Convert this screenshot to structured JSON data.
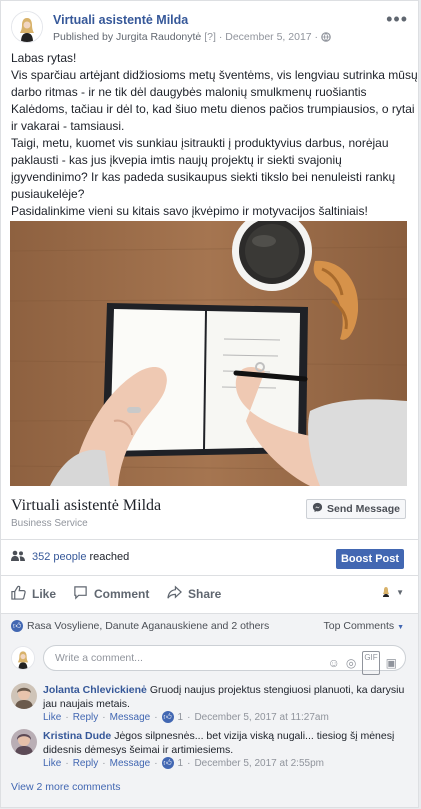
{
  "post": {
    "page_name": "Virtuali asistentė Milda",
    "published_by": "Published by",
    "author": "Jurgita Raudonytė",
    "help_mark": "[?]",
    "separator": "·",
    "date": "December 5, 2017",
    "privacy_icon": "globe-icon",
    "more_icon": "more-dots-icon",
    "lines": [
      "Labas rytas!",
      "Vis sparčiau artėjant didžiosioms metų šventėms, vis lengviau sutrinka mūsų",
      "darbo ritmas - ir ne tik dėl daugybės malonių smulkmenų ruošiantis",
      "Kalėdoms, tačiau ir dėl to, kad šiuo metu dienos pačios trumpiausios, o rytai",
      "ir vakarai - tamsiausi.",
      "Taigi, metu, kuomet vis sunkiau įsitraukti į produktyvius darbus, norėjau",
      "paklausti - kas jus įkvepia imtis naujų projektų ir siekti svajonių",
      "įgyvendinimo? Ir kas padeda susikaupus siekti tikslo bei nenuleisti rankų",
      "pusiaukelėje?",
      "Pasidalinkime vieni su kitais savo įkvėpimo ir motyvacijos šaltiniais!"
    ]
  },
  "link_card": {
    "title": "Virtuali asistentė Milda",
    "subtitle": "Business Service",
    "send_message": "Send Message"
  },
  "reach": {
    "count": "352 people",
    "suffix": "reached",
    "boost": "Boost Post"
  },
  "actions": {
    "like": "Like",
    "comment": "Comment",
    "share": "Share"
  },
  "reactions": {
    "names": "Rasa Vosyliene, Danute Aganauskiene and 2 others",
    "top_comments": "Top Comments",
    "dropdown_icon": "chevron-down-icon"
  },
  "composer": {
    "placeholder": "Write a comment..."
  },
  "comments": [
    {
      "name": "Jolanta Chlevickienė",
      "text_line1": "Gruodį naujus projektus stengiuosi planuoti, ka darysiu",
      "text_line2": "jau naujais metais.",
      "like": "Like",
      "reply": "Reply",
      "message": "Message",
      "likes": "1",
      "date": "December 5, 2017 at 11:27am",
      "avatar_color": "#6b5a4c"
    },
    {
      "name": "Kristina Dude",
      "text_line1": "Jėgos silpnesnės... bet vizija viską nugali... tiesiog šį mėnesį",
      "text_line2": "didesnis dėmesys šeimai ir artimiesiems.",
      "like": "Like",
      "reply": "Reply",
      "message": "Message",
      "likes": "1",
      "date": "December 5, 2017 at 2:55pm",
      "avatar_color": "#5c4a56"
    }
  ],
  "view_more": "View 2 more comments",
  "colors": {
    "link_blue": "#365899",
    "boost_blue": "#4267b2",
    "table_wood": "#9a6b47"
  }
}
